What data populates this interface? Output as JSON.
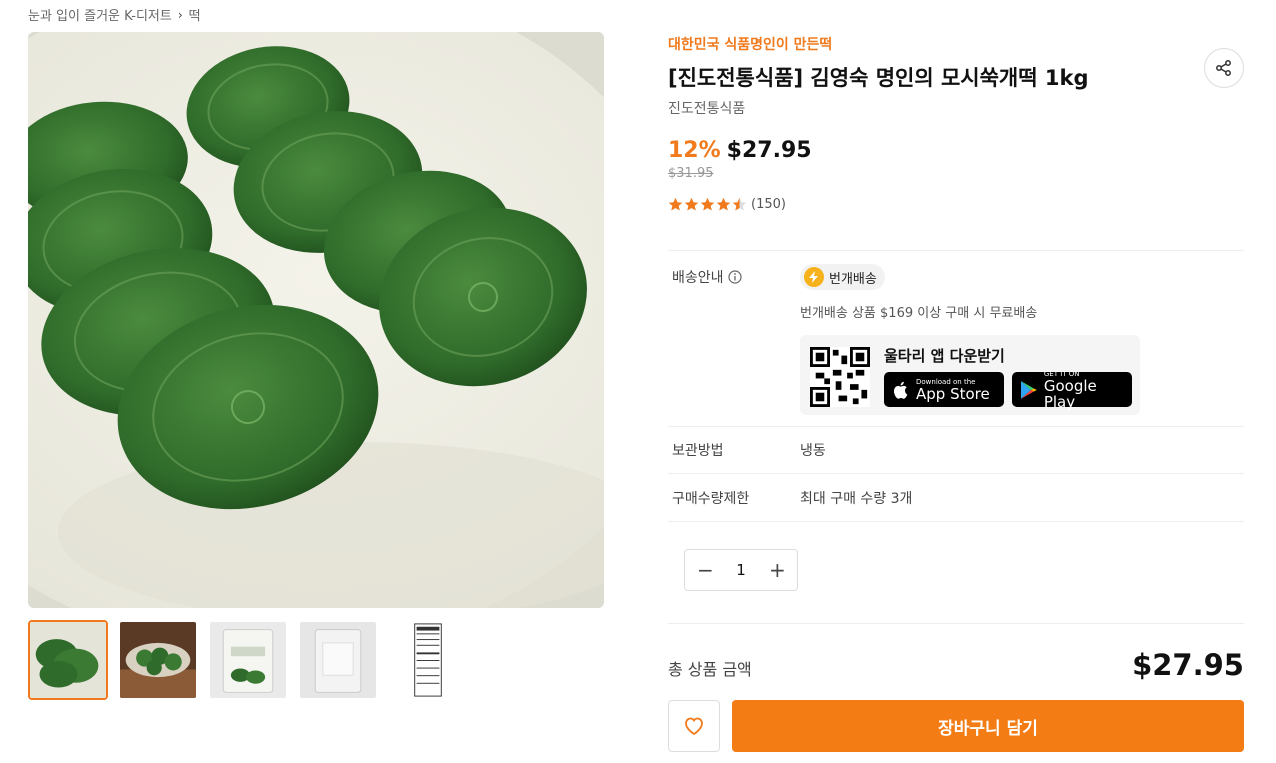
{
  "breadcrumb": {
    "items": [
      "눈과 입이 즐거운 K-디저트",
      "떡"
    ],
    "separator": "›"
  },
  "product": {
    "promo": "대한민국 식품명인이 만든떡",
    "title": "[진도전통식품] 김영숙 명인의 모시쑥개떡 1kg",
    "brand": "진도전통식품",
    "discount": "12%",
    "price": "$27.95",
    "original_price": "$31.95",
    "rating_value": 4.5,
    "review_count": "(150)"
  },
  "info": {
    "shipping_label": "배송안내",
    "shipping_badge": "번개배송",
    "shipping_desc": "번개배송 상품 $169 이상 구매 시 무료배송",
    "app_download": "울타리 앱 다운받기",
    "apple_small": "Download on the",
    "apple_big": "App Store",
    "google_small": "GET IT ON",
    "google_big": "Google Play",
    "storage_label": "보관방법",
    "storage_value": "냉동",
    "limit_label": "구매수량제한",
    "limit_value": "최대 구매 수량 3개"
  },
  "quantity": {
    "value": "1",
    "minus": "−",
    "plus": "+"
  },
  "total": {
    "label": "총 상품 금액",
    "value": "$27.95"
  },
  "actions": {
    "cart": "장바구니 담기"
  },
  "colors": {
    "accent": "#f37d14",
    "promo": "#f07a1c",
    "star": "#f07a1c",
    "rice_cake": "#2f6b2a"
  },
  "icons": {
    "share": "share-icon",
    "info": "info-icon",
    "flash": "lightning-icon",
    "heart": "heart-icon",
    "apple": "apple-icon",
    "google": "google-play-icon"
  }
}
